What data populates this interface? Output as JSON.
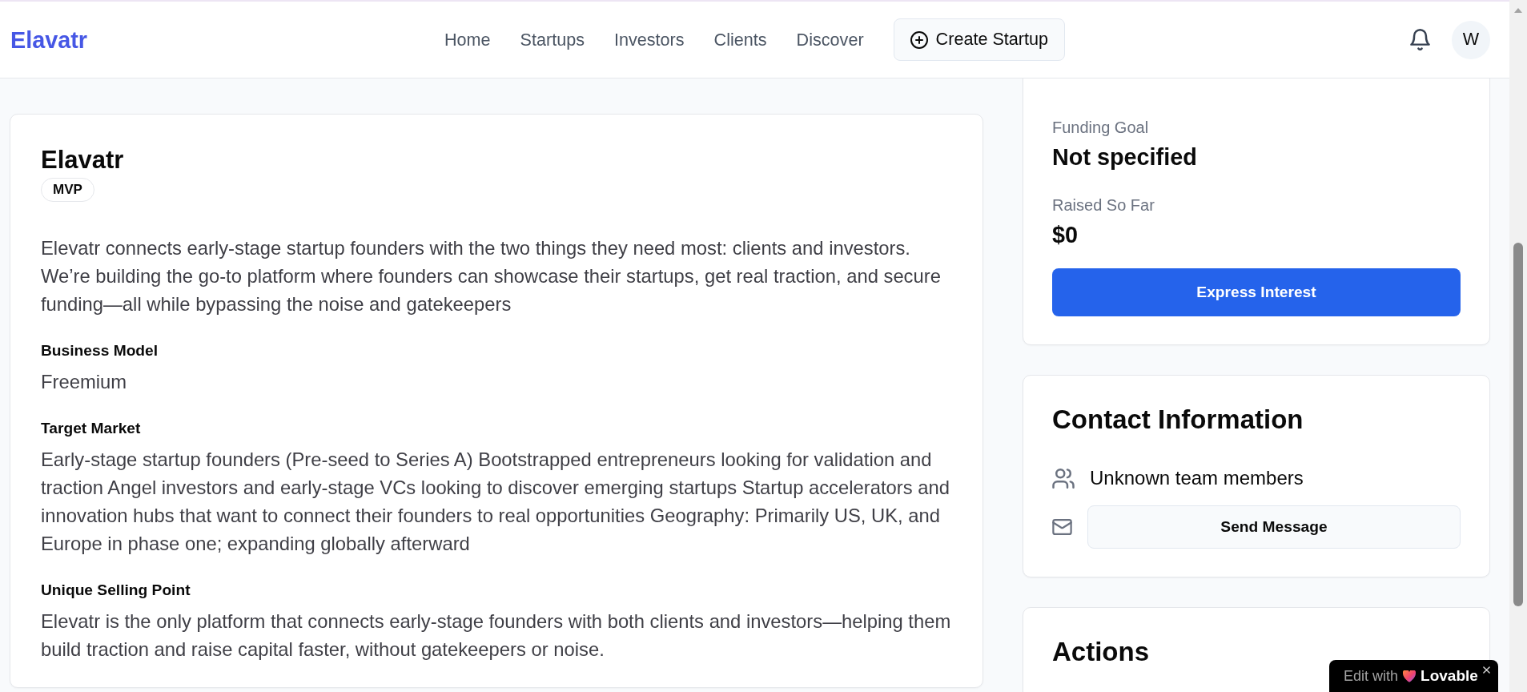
{
  "header": {
    "logo": "Elavatr",
    "nav": [
      {
        "label": "Home"
      },
      {
        "label": "Startups"
      },
      {
        "label": "Investors"
      },
      {
        "label": "Clients"
      },
      {
        "label": "Discover"
      }
    ],
    "create_button": "Create Startup",
    "avatar": "W"
  },
  "startup": {
    "name": "Elavatr",
    "stage": "MVP",
    "description": "Elevatr connects early-stage startup founders with the two things they need most: clients and investors. We’re building the go-to platform where founders can showcase their startups, get real traction, and secure funding—all while bypassing the noise and gatekeepers",
    "sections": [
      {
        "label": "Business Model",
        "value": "Freemium"
      },
      {
        "label": "Target Market",
        "value": "Early-stage startup founders (Pre-seed to Series A) Bootstrapped entrepreneurs looking for validation and traction Angel investors and early-stage VCs looking to discover emerging startups Startup accelerators and innovation hubs that want to connect their founders to real opportunities Geography: Primarily US, UK, and Europe in phase one; expanding globally afterward"
      },
      {
        "label": "Unique Selling Point",
        "value": "Elevatr is the only platform that connects early-stage founders with both clients and investors—helping them build traction and raise capital faster, without gatekeepers or noise."
      }
    ]
  },
  "funding": {
    "stats": [
      {
        "label": "Funding Goal",
        "value": "Not specified"
      },
      {
        "label": "Raised So Far",
        "value": "$0"
      }
    ],
    "button": "Express Interest"
  },
  "contact": {
    "title": "Contact Information",
    "team": "Unknown team members",
    "button": "Send Message"
  },
  "actions": {
    "title": "Actions"
  },
  "edit_badge": {
    "prefix": "Edit with",
    "brand": "Lovable"
  }
}
